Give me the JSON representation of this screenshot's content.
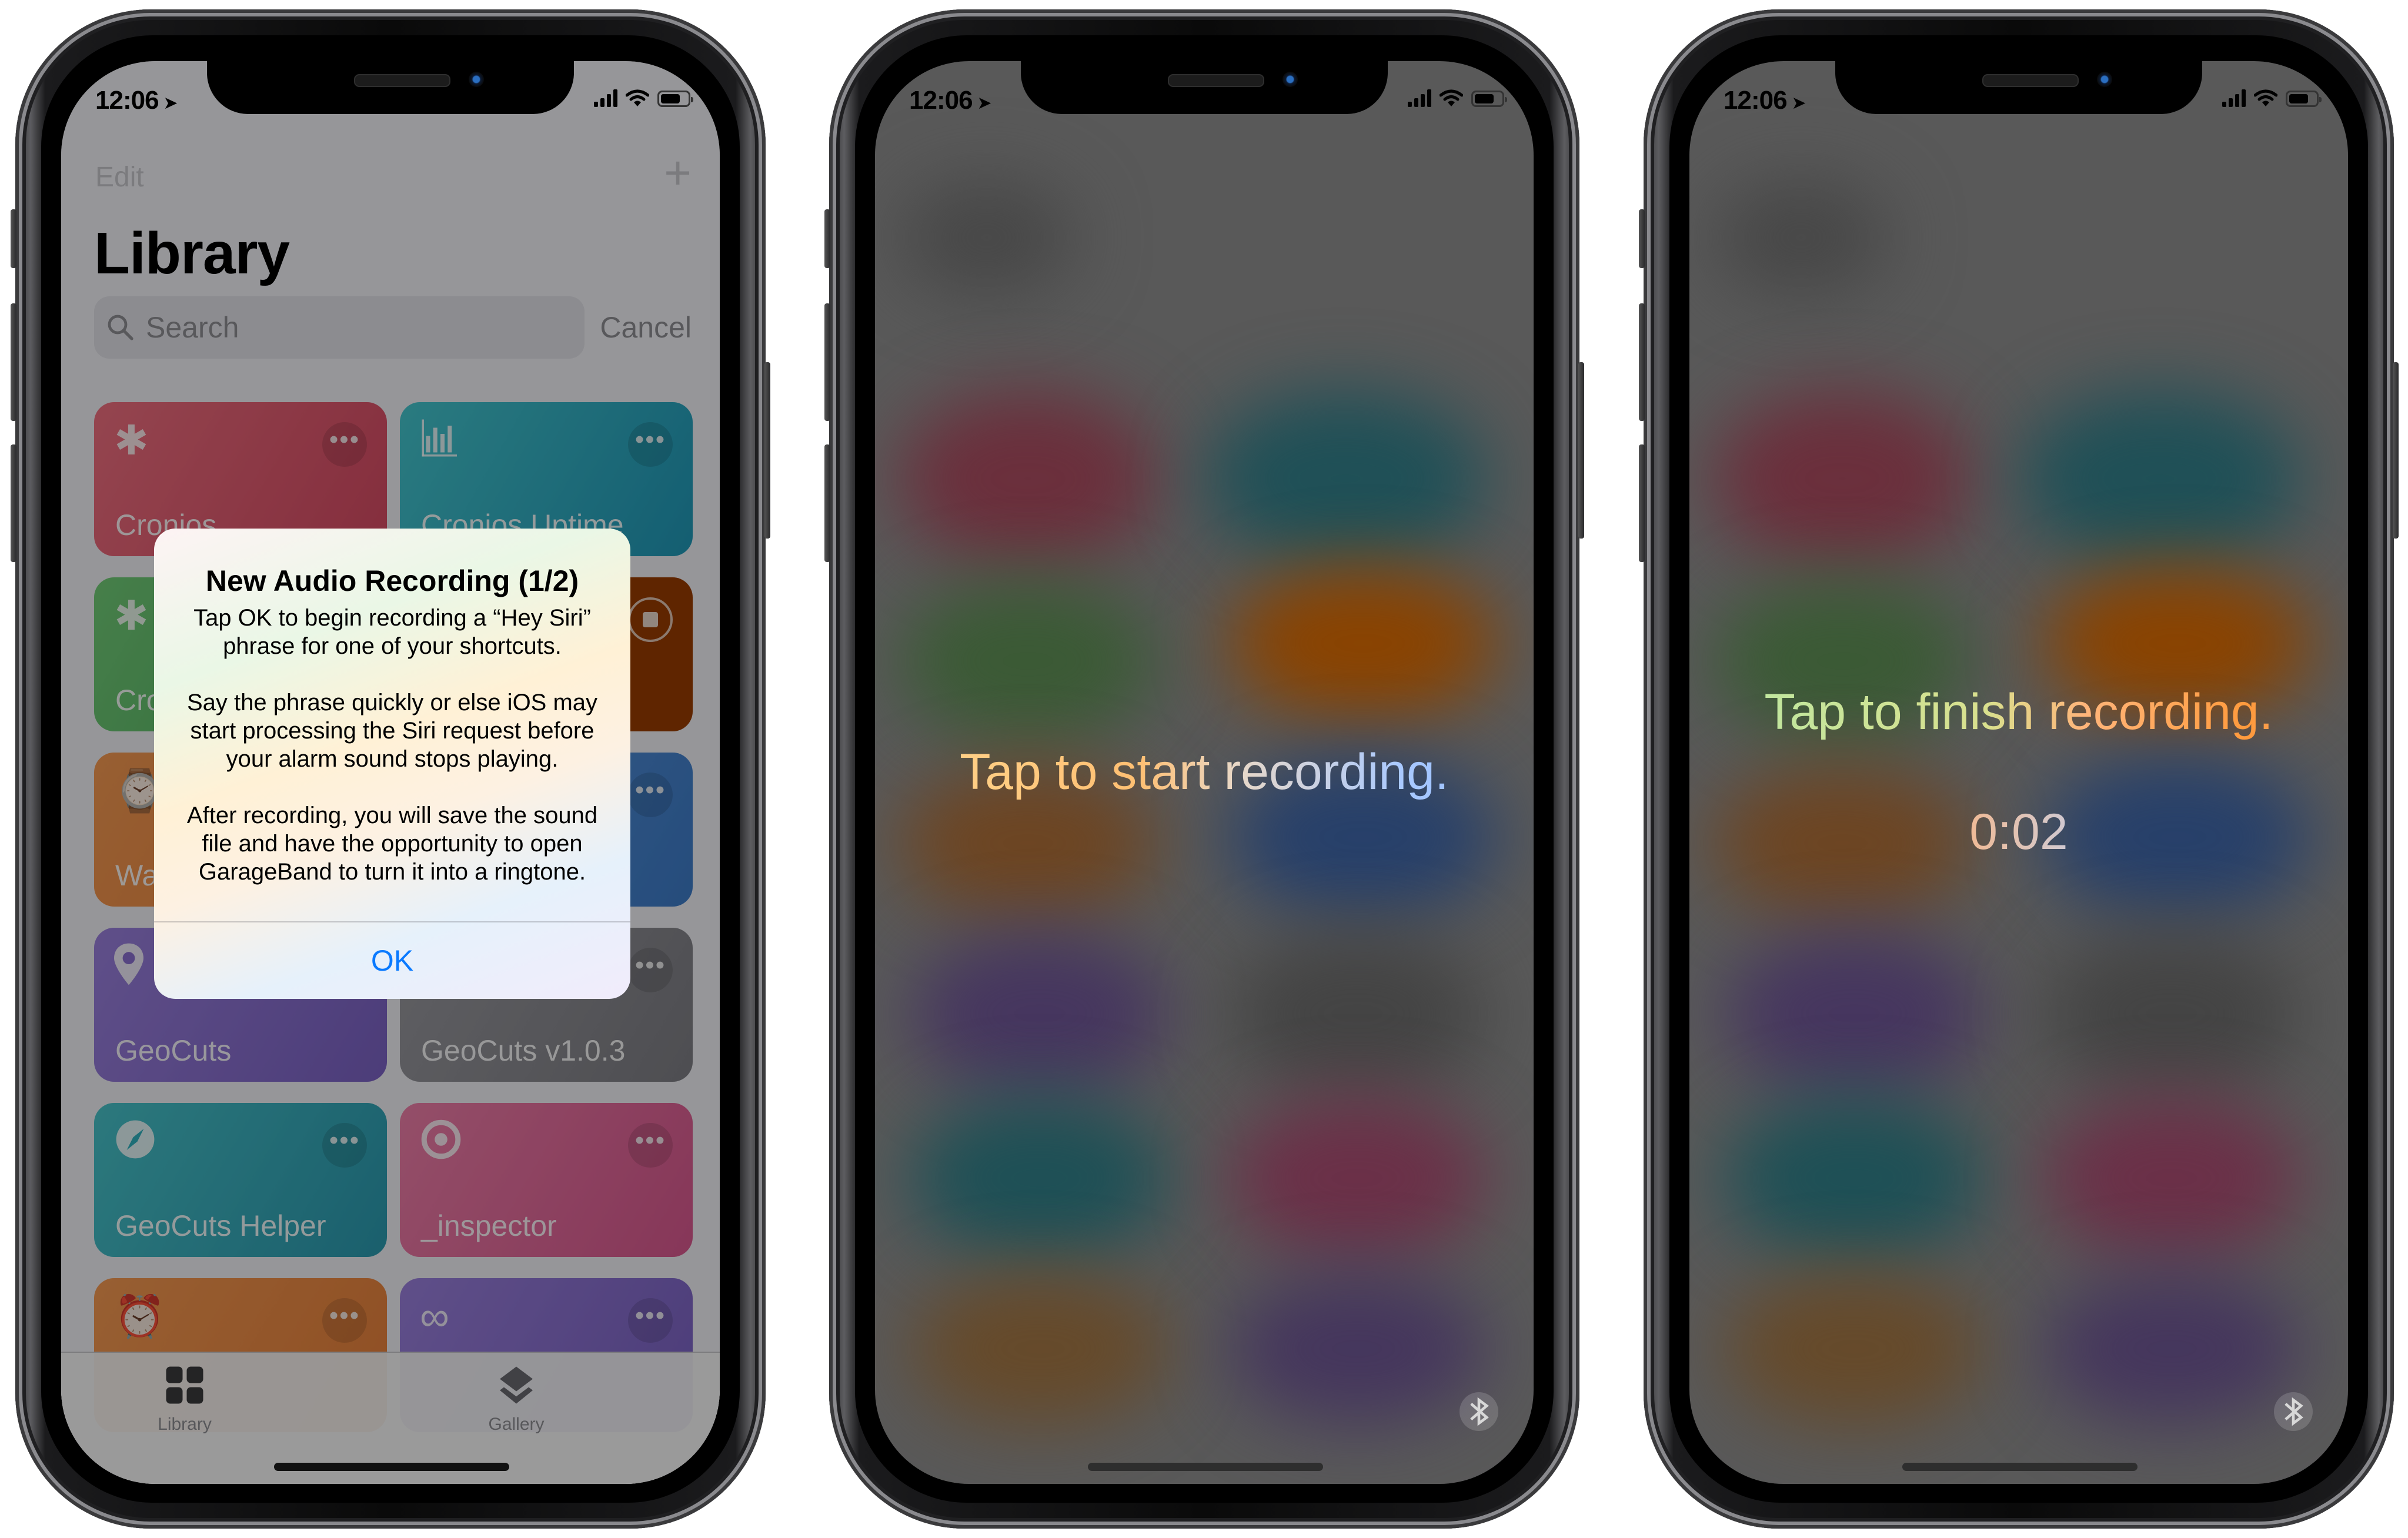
{
  "phones": [
    {
      "status_bar": {
        "time": "12:06",
        "location_icon": "location-arrow-icon",
        "icons": [
          "cellular-signal-icon",
          "wifi-icon",
          "battery-icon"
        ]
      },
      "library": {
        "edit_label": "Edit",
        "add_icon": "plus-icon",
        "title": "Library",
        "search": {
          "placeholder": "Search",
          "icon": "magnifying-glass-icon"
        },
        "cancel_label": "Cancel",
        "cards": [
          {
            "label": "Cronios",
            "icon": "asterisk-icon",
            "color": "#e05a6a"
          },
          {
            "label": "Cronios Uptime",
            "icon": "bar-chart-icon",
            "color": "#36b6c4"
          },
          {
            "label": "Cronios",
            "icon": "asterisk-icon",
            "color": "#64c16b"
          },
          {
            "label": "",
            "icon": "stop-icon",
            "color": "#d0690c"
          },
          {
            "label": "Wa",
            "icon": "watch-icon",
            "color": "#f08a3c"
          },
          {
            "label": "",
            "icon": "more-icon",
            "color": "#4a88d4"
          },
          {
            "label": "GeoCuts",
            "icon": "map-pin-icon",
            "color": "#8a6fd0"
          },
          {
            "label": "GeoCuts v1.0.3",
            "icon": "more-icon",
            "color": "#8e8e93"
          },
          {
            "label": "GeoCuts Helper",
            "icon": "compass-icon",
            "color": "#2fb2be"
          },
          {
            "label": "_inspector",
            "icon": "target-icon",
            "color": "#e56aa0"
          },
          {
            "label": "",
            "icon": "alarm-clock-icon",
            "color": "#f08a3c"
          },
          {
            "label": "",
            "icon": "infinity-icon",
            "color": "#8a6fd0"
          }
        ],
        "more_glyph": "•••",
        "tabs": [
          {
            "label": "Library",
            "icon": "grid-icon"
          },
          {
            "label": "Gallery",
            "icon": "layers-icon"
          }
        ]
      },
      "alert": {
        "title": "New Audio Recording (1/2)",
        "message": "Tap OK to begin recording a “Hey Siri” phrase for one of your shortcuts.\n\nSay the phrase quickly or else iOS may start processing the Siri request before your alarm sound stops playing.\n\nAfter recording, you will save the sound file and have the opportunity to open GarageBand to turn it into a ringtone.",
        "ok_label": "OK",
        "ok_color": "#0a7aff"
      }
    },
    {
      "status_bar": {
        "time": "12:06"
      },
      "prompt": "Tap to start recording.",
      "bluetooth_icon": "bluetooth-icon"
    },
    {
      "status_bar": {
        "time": "12:06"
      },
      "prompt": "Tap to finish recording.",
      "timer": "0:02",
      "bluetooth_icon": "bluetooth-icon"
    }
  ]
}
